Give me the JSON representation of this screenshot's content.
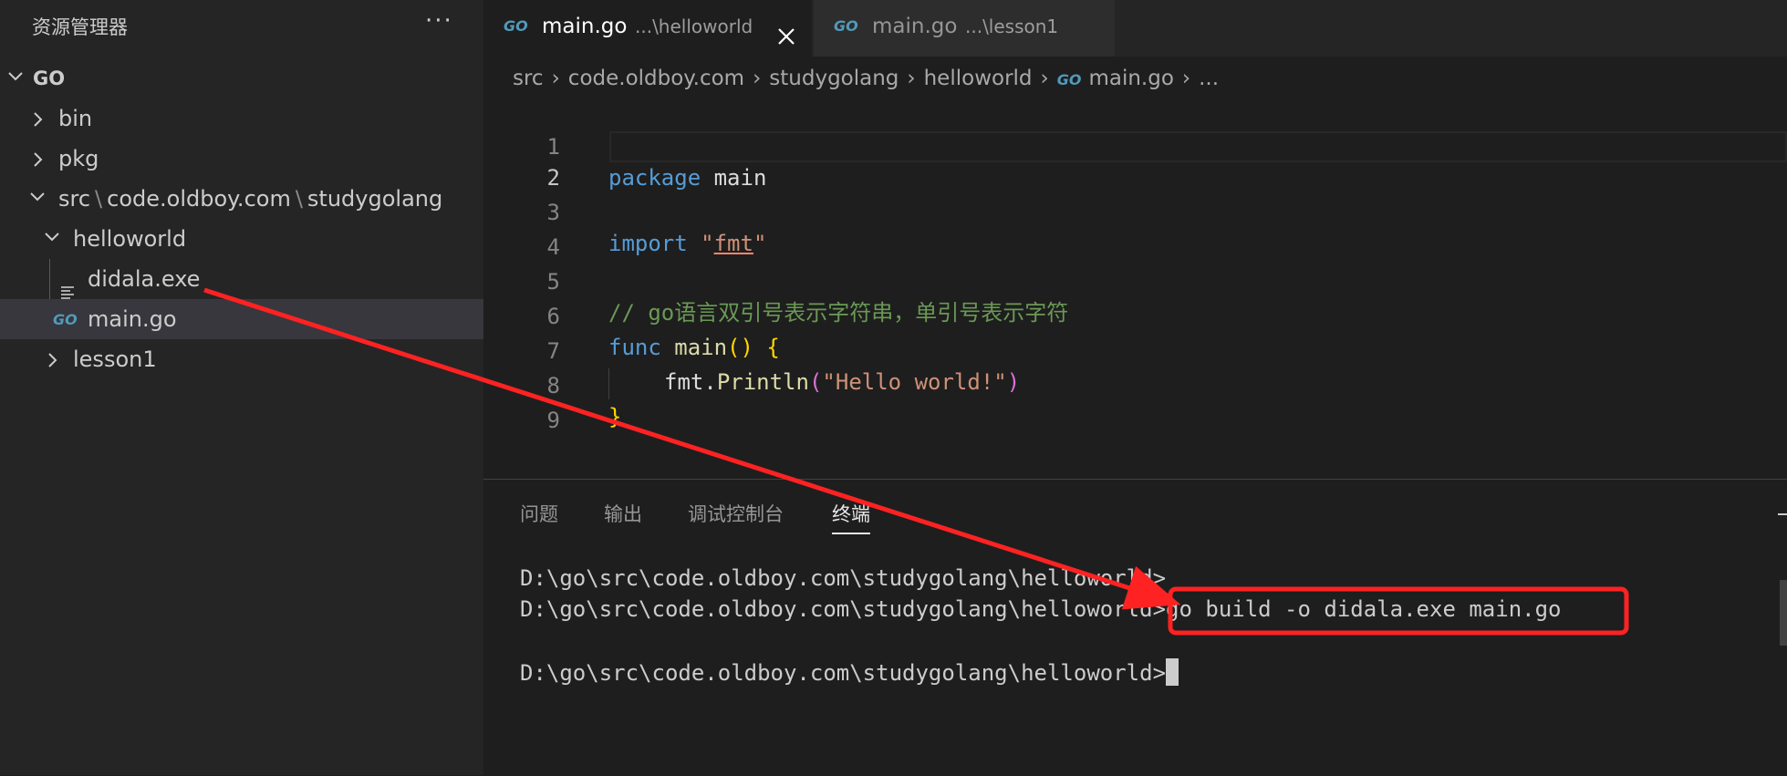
{
  "explorer": {
    "title": "资源管理器",
    "more_label": "···",
    "root": "GO",
    "tree": [
      {
        "label": "bin",
        "state": "collapsed"
      },
      {
        "label": "pkg",
        "state": "collapsed"
      },
      {
        "label_parts": [
          "src",
          "code.oldboy.com",
          "studygolang"
        ],
        "separator": "\\",
        "state": "expanded"
      },
      {
        "label": "helloworld",
        "state": "expanded"
      },
      {
        "label": "didala.exe",
        "icon": "text-file-icon"
      },
      {
        "label": "main.go",
        "icon": "go-file-icon",
        "selected": true
      },
      {
        "label": "lesson1",
        "state": "collapsed"
      }
    ]
  },
  "tabs": [
    {
      "icon": "GO",
      "name": "main.go",
      "description": "...\\helloworld",
      "active": true
    },
    {
      "icon": "GO",
      "name": "main.go",
      "description": "...\\lesson1",
      "active": false
    }
  ],
  "breadcrumb": {
    "items": [
      "src",
      "code.oldboy.com",
      "studygolang",
      "helloworld"
    ],
    "file_icon": "GO",
    "file": "main.go",
    "ellipsis": "..."
  },
  "editor": {
    "line_numbers": [
      "1",
      "2",
      "3",
      "4",
      "5",
      "6",
      "7",
      "8",
      "9"
    ],
    "current_line": "2",
    "tokens": {
      "l1_kw": "package",
      "l1_id": "main",
      "l3_kw": "import",
      "l3_q1": "\"",
      "l3_str": "fmt",
      "l3_q2": "\"",
      "l5_cm": "// go语言双引号表示字符串，单引号表示字符",
      "l6_kw": "func",
      "l6_fn": "main",
      "l6_par": "()",
      "l6_brace": "{",
      "l7_pkg": "fmt",
      "l7_dot": ".",
      "l7_fn": "Println",
      "l7_open": "(",
      "l7_str": "\"Hello world!\"",
      "l7_close": ")",
      "l8_brace": "}"
    }
  },
  "panel": {
    "tabs": [
      "问题",
      "输出",
      "调试控制台",
      "终端"
    ],
    "active_tab": "终端",
    "terminal_lines": [
      "D:\\go\\src\\code.oldboy.com\\studygolang\\helloworld>",
      "D:\\go\\src\\code.oldboy.com\\studygolang\\helloworld>",
      "",
      "D:\\go\\src\\code.oldboy.com\\studygolang\\helloworld>"
    ],
    "command": "go build -o didala.exe main.go"
  },
  "annotation": {
    "color": "#ff2222",
    "arrow_target": "didala.exe",
    "box_target": "go build -o didala.exe main.go"
  }
}
